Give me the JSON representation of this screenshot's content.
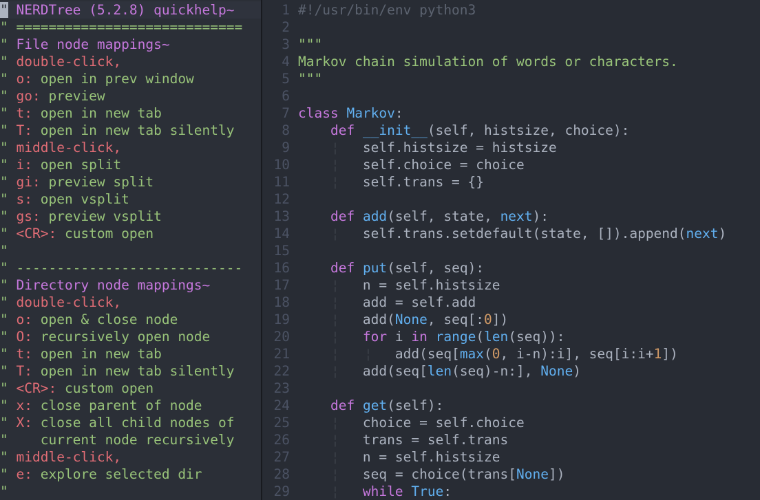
{
  "nerdtree": {
    "title": "NERDTree (5.2.8) quickhelp~",
    "lines": [
      {
        "kind": "title",
        "text": "NERDTree (5.2.8) quickhelp~"
      },
      {
        "kind": "sep",
        "text": "============================"
      },
      {
        "kind": "hdr",
        "text": "File node mappings~"
      },
      {
        "kind": "click",
        "text": "double-click,"
      },
      {
        "kind": "map",
        "key": "o",
        "desc": "open in prev window"
      },
      {
        "kind": "map",
        "key": "go",
        "desc": "preview"
      },
      {
        "kind": "map",
        "key": "t",
        "desc": "open in new tab"
      },
      {
        "kind": "map",
        "key": "T",
        "desc": "open in new tab silently"
      },
      {
        "kind": "click",
        "text": "middle-click,"
      },
      {
        "kind": "map",
        "key": "i",
        "desc": "open split"
      },
      {
        "kind": "map",
        "key": "gi",
        "desc": "preview split"
      },
      {
        "kind": "map",
        "key": "s",
        "desc": "open vsplit"
      },
      {
        "kind": "map",
        "key": "gs",
        "desc": "preview vsplit"
      },
      {
        "kind": "map",
        "key": "<CR>",
        "desc": "custom open"
      },
      {
        "kind": "blank",
        "text": ""
      },
      {
        "kind": "sep",
        "text": "----------------------------"
      },
      {
        "kind": "hdr",
        "text": "Directory node mappings~"
      },
      {
        "kind": "click",
        "text": "double-click,"
      },
      {
        "kind": "map",
        "key": "o",
        "desc": "open & close node"
      },
      {
        "kind": "map",
        "key": "O",
        "desc": "recursively open node"
      },
      {
        "kind": "map",
        "key": "t",
        "desc": "open in new tab"
      },
      {
        "kind": "map",
        "key": "T",
        "desc": "open in new tab silently"
      },
      {
        "kind": "map",
        "key": "<CR>",
        "desc": "custom open"
      },
      {
        "kind": "map",
        "key": "x",
        "desc": "close parent of node"
      },
      {
        "kind": "map",
        "key": "X",
        "desc": "close all child nodes of"
      },
      {
        "kind": "cont",
        "text": "   current node recursively"
      },
      {
        "kind": "click",
        "text": "middle-click,"
      },
      {
        "kind": "map",
        "key": "e",
        "desc": "explore selected dir"
      },
      {
        "kind": "blank",
        "text": ""
      }
    ]
  },
  "editor": {
    "language": "python",
    "lines": [
      {
        "n": "1",
        "guides": 0,
        "tokens": [
          [
            "cm",
            "#!/usr/bin/env python3"
          ]
        ]
      },
      {
        "n": "2",
        "guides": 0,
        "tokens": []
      },
      {
        "n": "3",
        "guides": 0,
        "tokens": [
          [
            "str",
            "\"\"\""
          ]
        ]
      },
      {
        "n": "4",
        "guides": 0,
        "tokens": [
          [
            "str",
            "Markov chain simulation of words or characters."
          ]
        ]
      },
      {
        "n": "5",
        "guides": 0,
        "tokens": [
          [
            "str",
            "\"\"\""
          ]
        ]
      },
      {
        "n": "6",
        "guides": 0,
        "tokens": []
      },
      {
        "n": "7",
        "guides": 0,
        "tokens": [
          [
            "kw",
            "class"
          ],
          [
            "pl",
            " "
          ],
          [
            "cls",
            "Markov"
          ],
          [
            "pl",
            ":"
          ]
        ]
      },
      {
        "n": "8",
        "guides": 0,
        "tokens": [
          [
            "pl",
            "    "
          ],
          [
            "kw",
            "def"
          ],
          [
            "pl",
            " "
          ],
          [
            "fn",
            "__init__"
          ],
          [
            "pl",
            "(self, histsize, choice):"
          ]
        ]
      },
      {
        "n": "9",
        "guides": 1,
        "tokens": [
          [
            "pl",
            "        self.histsize = histsize"
          ]
        ]
      },
      {
        "n": "10",
        "guides": 1,
        "tokens": [
          [
            "pl",
            "        self.choice = choice"
          ]
        ]
      },
      {
        "n": "11",
        "guides": 1,
        "tokens": [
          [
            "pl",
            "        self.trans = {}"
          ]
        ]
      },
      {
        "n": "12",
        "guides": 0,
        "tokens": []
      },
      {
        "n": "13",
        "guides": 0,
        "tokens": [
          [
            "pl",
            "    "
          ],
          [
            "kw",
            "def"
          ],
          [
            "pl",
            " "
          ],
          [
            "fn",
            "add"
          ],
          [
            "pl",
            "(self, state, "
          ],
          [
            "bi",
            "next"
          ],
          [
            "pl",
            "):"
          ]
        ]
      },
      {
        "n": "14",
        "guides": 1,
        "tokens": [
          [
            "pl",
            "        self.trans.setdefault(state, []).append("
          ],
          [
            "bi",
            "next"
          ],
          [
            "pl",
            ")"
          ]
        ]
      },
      {
        "n": "15",
        "guides": 0,
        "tokens": []
      },
      {
        "n": "16",
        "guides": 0,
        "tokens": [
          [
            "pl",
            "    "
          ],
          [
            "kw",
            "def"
          ],
          [
            "pl",
            " "
          ],
          [
            "fn",
            "put"
          ],
          [
            "pl",
            "(self, seq):"
          ]
        ]
      },
      {
        "n": "17",
        "guides": 1,
        "tokens": [
          [
            "pl",
            "        n = self.histsize"
          ]
        ]
      },
      {
        "n": "18",
        "guides": 1,
        "tokens": [
          [
            "pl",
            "        add = self.add"
          ]
        ]
      },
      {
        "n": "19",
        "guides": 1,
        "tokens": [
          [
            "pl",
            "        add("
          ],
          [
            "bi",
            "None"
          ],
          [
            "pl",
            ", seq[:"
          ],
          [
            "num",
            "0"
          ],
          [
            "pl",
            "])"
          ]
        ]
      },
      {
        "n": "20",
        "guides": 1,
        "tokens": [
          [
            "pl",
            "        "
          ],
          [
            "kw",
            "for"
          ],
          [
            "pl",
            " i "
          ],
          [
            "kw",
            "in"
          ],
          [
            "pl",
            " "
          ],
          [
            "bi",
            "range"
          ],
          [
            "pl",
            "("
          ],
          [
            "bi",
            "len"
          ],
          [
            "pl",
            "(seq)):"
          ]
        ]
      },
      {
        "n": "21",
        "guides": 2,
        "tokens": [
          [
            "pl",
            "            add(seq["
          ],
          [
            "bi",
            "max"
          ],
          [
            "pl",
            "("
          ],
          [
            "num",
            "0"
          ],
          [
            "pl",
            ", i-n):i], seq[i:i+"
          ],
          [
            "num",
            "1"
          ],
          [
            "pl",
            "])"
          ]
        ]
      },
      {
        "n": "22",
        "guides": 1,
        "tokens": [
          [
            "pl",
            "        add(seq["
          ],
          [
            "bi",
            "len"
          ],
          [
            "pl",
            "(seq)-n:], "
          ],
          [
            "bi",
            "None"
          ],
          [
            "pl",
            ")"
          ]
        ]
      },
      {
        "n": "23",
        "guides": 0,
        "tokens": []
      },
      {
        "n": "24",
        "guides": 0,
        "tokens": [
          [
            "pl",
            "    "
          ],
          [
            "kw",
            "def"
          ],
          [
            "pl",
            " "
          ],
          [
            "fn",
            "get"
          ],
          [
            "pl",
            "(self):"
          ]
        ]
      },
      {
        "n": "25",
        "guides": 1,
        "tokens": [
          [
            "pl",
            "        choice = self.choice"
          ]
        ]
      },
      {
        "n": "26",
        "guides": 1,
        "tokens": [
          [
            "pl",
            "        trans = self.trans"
          ]
        ]
      },
      {
        "n": "27",
        "guides": 1,
        "tokens": [
          [
            "pl",
            "        n = self.histsize"
          ]
        ]
      },
      {
        "n": "28",
        "guides": 1,
        "tokens": [
          [
            "pl",
            "        seq = choice(trans["
          ],
          [
            "bi",
            "None"
          ],
          [
            "pl",
            "])"
          ]
        ]
      },
      {
        "n": "29",
        "guides": 1,
        "tokens": [
          [
            "pl",
            "        "
          ],
          [
            "kw",
            "while"
          ],
          [
            "pl",
            " "
          ],
          [
            "bi",
            "True"
          ],
          [
            "pl",
            ":"
          ]
        ]
      }
    ]
  },
  "colors": {
    "background": "#282c34",
    "keyword": "#c678dd",
    "function": "#61afef",
    "string": "#98c379",
    "number": "#d19a66",
    "comment": "#5c6370",
    "mapping_key": "#e06c75",
    "line_number": "#4b5263"
  }
}
